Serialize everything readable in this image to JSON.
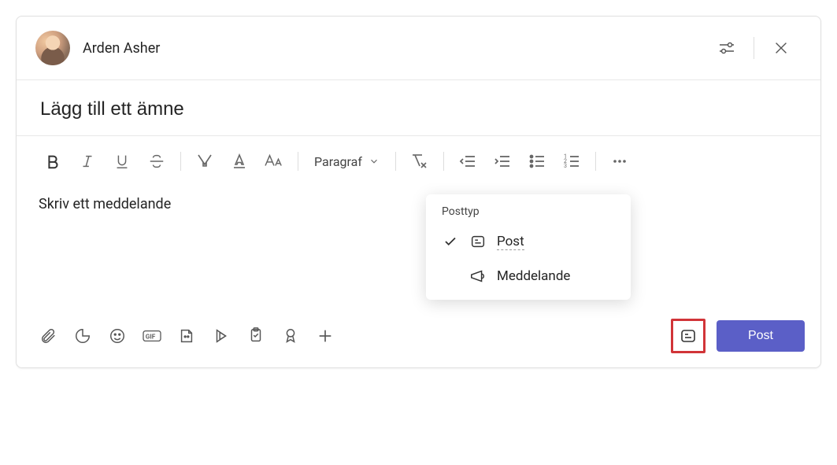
{
  "header": {
    "author_name": "Arden Asher"
  },
  "subject": {
    "placeholder": "Lägg till ett ämne"
  },
  "toolbar": {
    "paragraph_label": "Paragraf"
  },
  "body": {
    "placeholder": "Skriv ett meddelande"
  },
  "popup": {
    "title": "Posttyp",
    "items": [
      {
        "label": "Post",
        "selected": true
      },
      {
        "label": "Meddelande",
        "selected": false
      }
    ]
  },
  "actions": {
    "post_label": "Post"
  },
  "colors": {
    "accent": "#5b5fc7",
    "highlight_border": "#d13438"
  }
}
